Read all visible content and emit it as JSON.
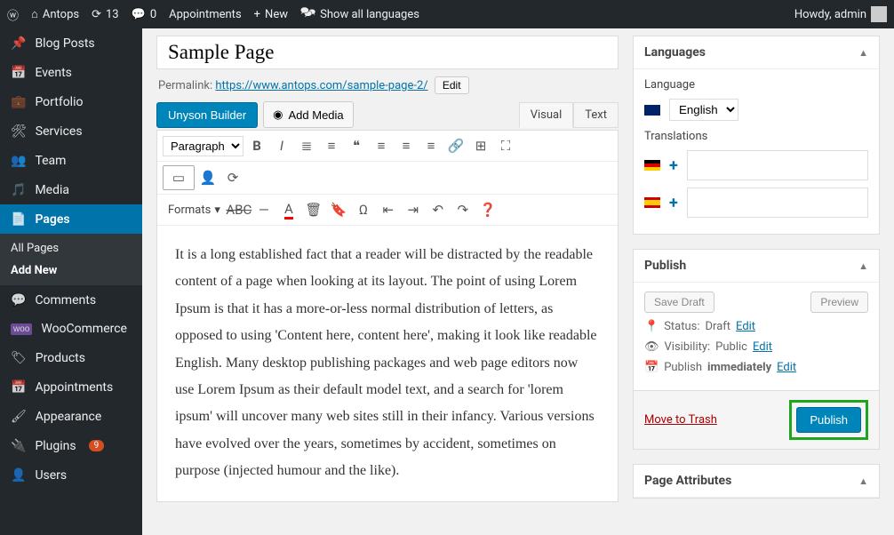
{
  "topbar": {
    "site": "Antops",
    "updates": "13",
    "comments": "0",
    "appointments": "Appointments",
    "new": "New",
    "langs": "Show all languages",
    "howdy": "Howdy, admin"
  },
  "sidebar": {
    "items": [
      {
        "icon": "📌",
        "label": "Blog Posts"
      },
      {
        "icon": "📅",
        "label": "Events"
      },
      {
        "icon": "💼",
        "label": "Portfolio"
      },
      {
        "icon": "🔧",
        "label": "Services"
      },
      {
        "icon": "👥",
        "label": "Team"
      },
      {
        "icon": "🎵",
        "label": "Media"
      },
      {
        "icon": "📄",
        "label": "Pages"
      },
      {
        "icon": "💬",
        "label": "Comments"
      },
      {
        "icon": "woo",
        "label": "WooCommerce"
      },
      {
        "icon": "🏷",
        "label": "Products"
      },
      {
        "icon": "📅",
        "label": "Appointments"
      },
      {
        "icon": "🎨",
        "label": "Appearance"
      },
      {
        "icon": "🔌",
        "label": "Plugins"
      },
      {
        "icon": "👤",
        "label": "Users"
      }
    ],
    "sub": [
      "All Pages",
      "Add New"
    ],
    "plugins_badge": "9"
  },
  "page": {
    "title": "Sample Page",
    "permalink_label": "Permalink:",
    "permalink_url": "https://www.antops.com/sample-page-2/",
    "edit": "Edit",
    "builder": "Unyson Builder",
    "addmedia": "Add Media",
    "tabs": {
      "visual": "Visual",
      "text": "Text"
    },
    "editor": {
      "paragraph": "Paragraph",
      "formats": "Formats",
      "body": "It is a long established fact that a reader will be distracted by the readable content of a page when looking at its layout. The point of using Lorem Ipsum is that it has a more-or-less normal distribution of letters, as opposed to using 'Content here, content here', making it look like readable English. Many desktop publishing packages and web page editors now use Lorem Ipsum as their default model text, and a search for 'lorem ipsum' will uncover many web sites still in their infancy. Various versions have evolved over the years, sometimes by accident, sometimes on purpose (injected humour and the like)."
    }
  },
  "languages": {
    "title": "Languages",
    "label": "Language",
    "selected": "English",
    "translations": "Translations"
  },
  "publish": {
    "title": "Publish",
    "savedraft": "Save Draft",
    "preview": "Preview",
    "status_lbl": "Status:",
    "status_val": "Draft",
    "vis_lbl": "Visibility:",
    "vis_val": "Public",
    "sched_lbl": "Publish",
    "sched_val": "immediately",
    "trash": "Move to Trash",
    "button": "Publish",
    "edit": "Edit"
  },
  "attrs": {
    "title": "Page Attributes"
  }
}
